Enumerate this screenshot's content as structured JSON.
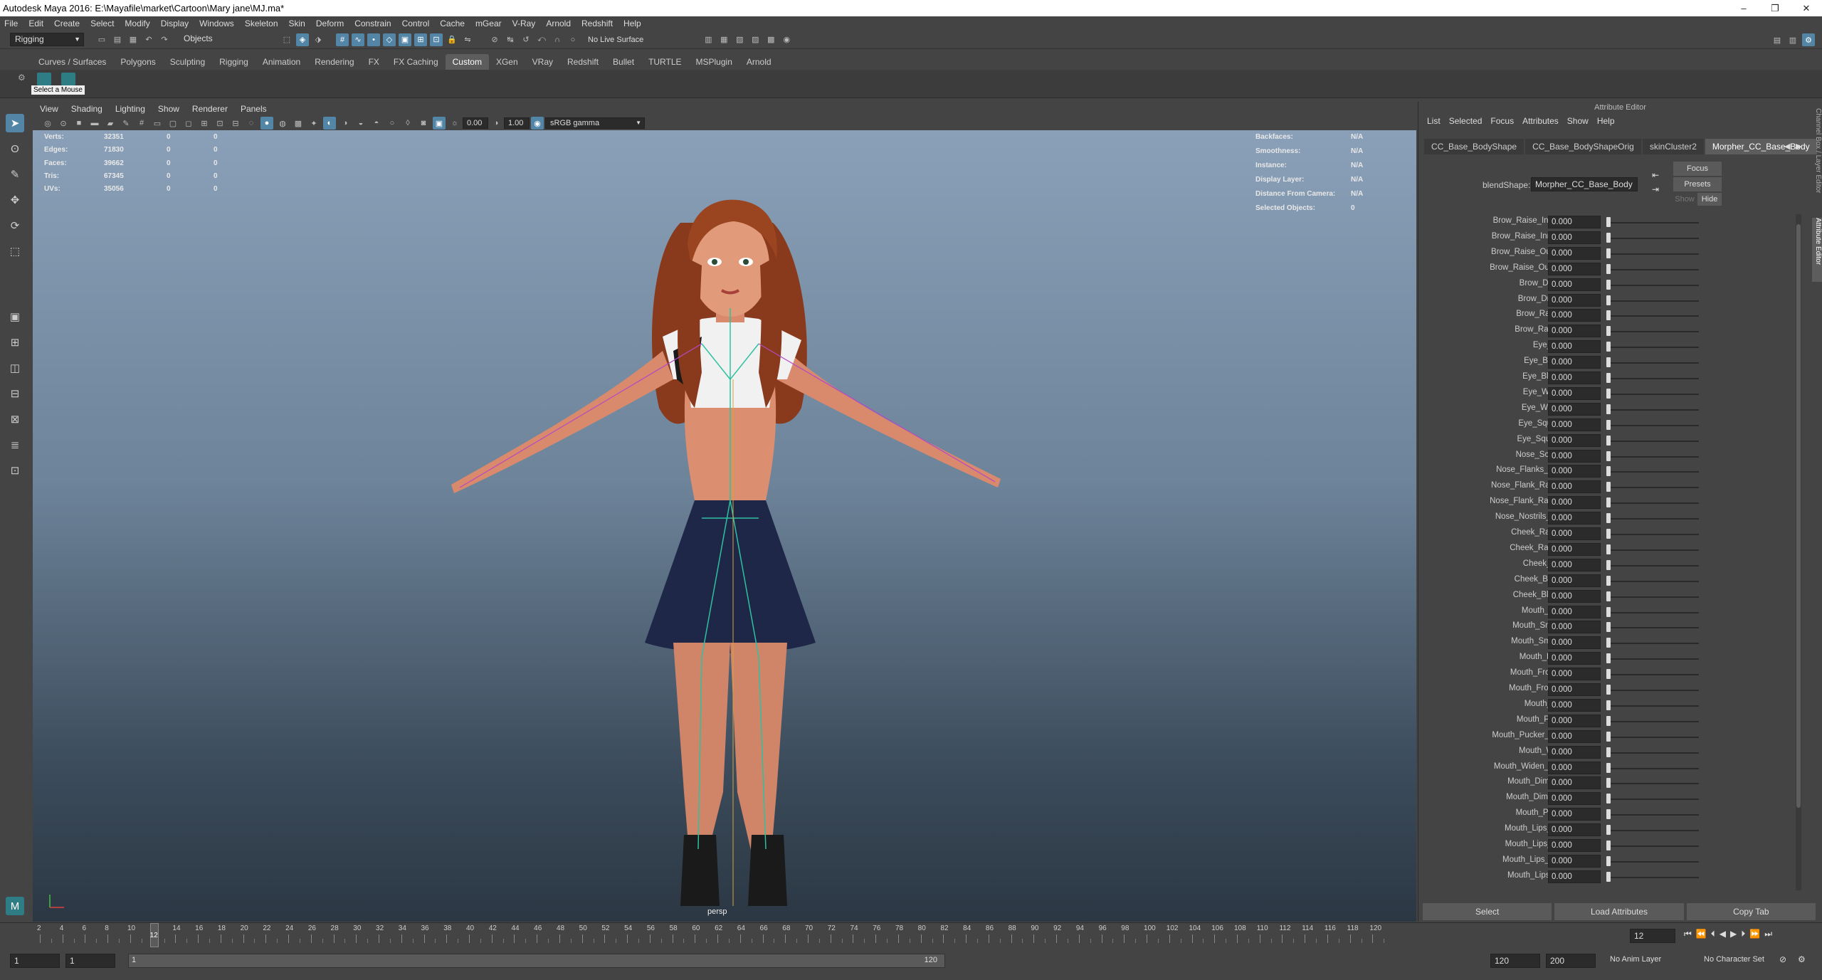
{
  "window": {
    "title": "Autodesk Maya 2016: E:\\Mayafile\\market\\Cartoon\\Mary jane\\MJ.ma*",
    "min": "–",
    "max": "❐",
    "close": "✕"
  },
  "menus": [
    "File",
    "Edit",
    "Create",
    "Select",
    "Modify",
    "Display",
    "Windows",
    "Skeleton",
    "Skin",
    "Deform",
    "Constrain",
    "Control",
    "Cache",
    "mGear",
    "V-Ray",
    "Arnold",
    "Redshift",
    "Help"
  ],
  "status": {
    "menuset": "Rigging",
    "selmode": "Objects",
    "live_surface": "No Live Surface"
  },
  "shelf_tabs": [
    "Curves / Surfaces",
    "Polygons",
    "Sculpting",
    "Rigging",
    "Animation",
    "Rendering",
    "FX",
    "FX Caching",
    "Custom",
    "XGen",
    "VRay",
    "Redshift",
    "Bullet",
    "TURTLE",
    "MSPlugin",
    "Arnold"
  ],
  "shelf_active": "Custom",
  "shelf_tooltip": "Select a Mouse",
  "viewport": {
    "menus": [
      "View",
      "Shading",
      "Lighting",
      "Show",
      "Renderer",
      "Panels"
    ],
    "exposure": "0.00",
    "gamma": "1.00",
    "colorspace": "sRGB gamma",
    "camera": "persp",
    "hud_left": [
      {
        "label": "Verts:",
        "a": "32351",
        "b": "0",
        "c": "0"
      },
      {
        "label": "Edges:",
        "a": "71830",
        "b": "0",
        "c": "0"
      },
      {
        "label": "Faces:",
        "a": "39662",
        "b": "0",
        "c": "0"
      },
      {
        "label": "Tris:",
        "a": "67345",
        "b": "0",
        "c": "0"
      },
      {
        "label": "UVs:",
        "a": "35056",
        "b": "0",
        "c": "0"
      }
    ],
    "hud_right": [
      {
        "label": "Backfaces:",
        "v": "N/A"
      },
      {
        "label": "Smoothness:",
        "v": "N/A"
      },
      {
        "label": "Instance:",
        "v": "N/A"
      },
      {
        "label": "Display Layer:",
        "v": "N/A"
      },
      {
        "label": "Distance From Camera:",
        "v": "N/A"
      },
      {
        "label": "Selected Objects:",
        "v": "0"
      }
    ]
  },
  "attribute_editor": {
    "title": "Attribute Editor",
    "menus": [
      "List",
      "Selected",
      "Focus",
      "Attributes",
      "Show",
      "Help"
    ],
    "tabs": [
      "CC_Base_BodyShape",
      "CC_Base_BodyShapeOrig",
      "skinCluster2",
      "Morpher_CC_Base_Body"
    ],
    "active_tab": "Morpher_CC_Base_Body",
    "blendshape_label": "blendShape:",
    "blendshape_value": "Morpher_CC_Base_Body",
    "focus": "Focus",
    "presets": "Presets",
    "show": "Show",
    "hide": "Hide",
    "attrs": [
      {
        "name": "Brow_Raise_Inner_L",
        "value": "0.000"
      },
      {
        "name": "Brow_Raise_Inner_R",
        "value": "0.000"
      },
      {
        "name": "Brow_Raise_Outer_L",
        "value": "0.000"
      },
      {
        "name": "Brow_Raise_Outer_R",
        "value": "0.000"
      },
      {
        "name": "Brow_Drop_L",
        "value": "0.000"
      },
      {
        "name": "Brow_Drop_R",
        "value": "0.000"
      },
      {
        "name": "Brow_Raise_L",
        "value": "0.000"
      },
      {
        "name": "Brow_Raise_R",
        "value": "0.000"
      },
      {
        "name": "Eye_Blink",
        "value": "0.000"
      },
      {
        "name": "Eye_Blink_L",
        "value": "0.000"
      },
      {
        "name": "Eye_Blink_R",
        "value": "0.000"
      },
      {
        "name": "Eye_Wide_L",
        "value": "0.000"
      },
      {
        "name": "Eye_Wide_R",
        "value": "0.000"
      },
      {
        "name": "Eye_Squint_L",
        "value": "0.000"
      },
      {
        "name": "Eye_Squint_R",
        "value": "0.000"
      },
      {
        "name": "Nose_Scrunch",
        "value": "0.000"
      },
      {
        "name": "Nose_Flanks_Raise",
        "value": "0.000"
      },
      {
        "name": "Nose_Flank_Raise_L",
        "value": "0.000"
      },
      {
        "name": "Nose_Flank_Raise_R",
        "value": "0.000"
      },
      {
        "name": "Nose_Nostrils_Flare",
        "value": "0.000"
      },
      {
        "name": "Cheek_Raise_L",
        "value": "0.000"
      },
      {
        "name": "Cheek_Raise_R",
        "value": "0.000"
      },
      {
        "name": "Cheek_Suck",
        "value": "0.000"
      },
      {
        "name": "Cheek_Blow_L",
        "value": "0.000"
      },
      {
        "name": "Cheek_Blow_R",
        "value": "0.000"
      },
      {
        "name": "Mouth_Smile",
        "value": "0.000"
      },
      {
        "name": "Mouth_Smile_L",
        "value": "0.000"
      },
      {
        "name": "Mouth_Smile_R",
        "value": "0.000"
      },
      {
        "name": "Mouth_Frown",
        "value": "0.000"
      },
      {
        "name": "Mouth_Frown_L",
        "value": "0.000"
      },
      {
        "name": "Mouth_Frown_R",
        "value": "0.000"
      },
      {
        "name": "Mouth_Blow",
        "value": "0.000"
      },
      {
        "name": "Mouth_Pucker",
        "value": "0.000"
      },
      {
        "name": "Mouth_Pucker_Open",
        "value": "0.000"
      },
      {
        "name": "Mouth_Widen",
        "value": "0.000"
      },
      {
        "name": "Mouth_Widen_Sides",
        "value": "0.000"
      },
      {
        "name": "Mouth_Dimple_L",
        "value": "0.000"
      },
      {
        "name": "Mouth_Dimple_R",
        "value": "0.000"
      },
      {
        "name": "Mouth_Plosive",
        "value": "0.000"
      },
      {
        "name": "Mouth_Lips_Tight",
        "value": "0.000"
      },
      {
        "name": "Mouth_Lips_Tuck",
        "value": "0.000"
      },
      {
        "name": "Mouth_Lips_Open",
        "value": "0.000"
      },
      {
        "name": "Mouth_Lips_Part",
        "value": "0.000"
      }
    ],
    "buttons": [
      "Select",
      "Load Attributes",
      "Copy Tab"
    ]
  },
  "side_tabs": [
    "Channel Box / Layer Editor",
    "Attribute Editor"
  ],
  "timeline": {
    "ticks": [
      "2",
      "4",
      "6",
      "8",
      "10",
      "12",
      "14",
      "16",
      "18",
      "20",
      "22",
      "24",
      "26",
      "28",
      "30",
      "32",
      "34",
      "36",
      "38",
      "40",
      "42",
      "44",
      "46",
      "48",
      "50",
      "52",
      "54",
      "56",
      "58",
      "60",
      "62",
      "64",
      "66",
      "68",
      "70",
      "72",
      "74",
      "76",
      "78",
      "80",
      "82",
      "84",
      "86",
      "88",
      "90",
      "92",
      "94",
      "96",
      "98",
      "100",
      "102",
      "104",
      "106",
      "108",
      "110",
      "112",
      "114",
      "116",
      "118",
      "120"
    ],
    "current": "12",
    "current_field": "12"
  },
  "range": {
    "start": "1",
    "start2": "1",
    "range_start_label": "1",
    "range_end_label": "120",
    "end": "120",
    "end2": "200",
    "anim_layer": "No Anim Layer",
    "char_set": "No Character Set"
  },
  "colors": {
    "accent": "#5285a6",
    "panel": "#444444",
    "field": "#2b2b2b"
  }
}
